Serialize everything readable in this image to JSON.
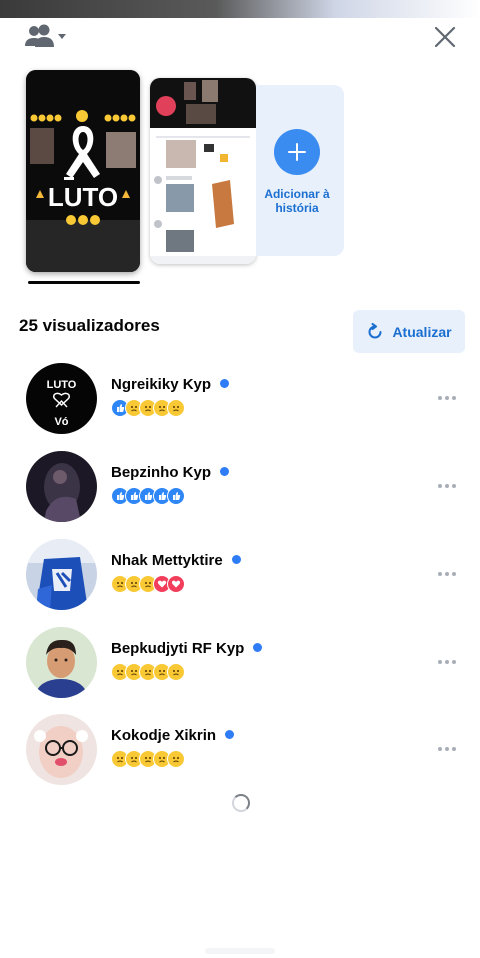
{
  "stories": {
    "story_1": {
      "main_text": "LUTO"
    },
    "add_story_label": "Adicionar à história"
  },
  "viewers_title": "25 visualizadores",
  "refresh_label": "Atualizar",
  "avatar_texts": {
    "line1": "LUTO",
    "line2": "Vó"
  },
  "viewers": [
    {
      "name": "Ngreikiky Kyp",
      "reactions": [
        "like",
        "sad",
        "sad",
        "sad",
        "sad"
      ]
    },
    {
      "name": "Bepzinho Kyp",
      "reactions": [
        "like",
        "like",
        "like",
        "like",
        "like"
      ]
    },
    {
      "name": "Nhak Mettyktire",
      "reactions": [
        "sad",
        "sad",
        "sad",
        "love",
        "love"
      ]
    },
    {
      "name": "Bepkudjyti RF Kyp",
      "reactions": [
        "sad",
        "sad",
        "sad",
        "sad",
        "sad"
      ]
    },
    {
      "name": "Kokodje Xikrin",
      "reactions": [
        "sad",
        "sad",
        "sad",
        "sad",
        "sad"
      ]
    }
  ],
  "icons": [
    "audience-icon",
    "close-icon",
    "plus-icon",
    "refresh-icon",
    "more-icon",
    "spinner-icon"
  ],
  "colors": {
    "accent": "#1b6fd1",
    "accent_bg": "#e7f0fb",
    "online": "#2e7cf6"
  }
}
